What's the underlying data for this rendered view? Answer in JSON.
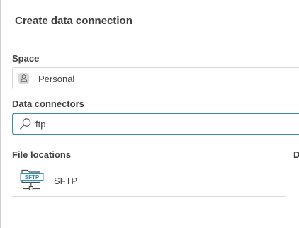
{
  "dialog": {
    "title": "Create data connection"
  },
  "space": {
    "label": "Space",
    "value": "Personal",
    "icon": "person-icon"
  },
  "connectors": {
    "label": "Data connectors",
    "search_value": "ftp",
    "search_icon": "search-icon"
  },
  "results": {
    "section_label": "File locations",
    "right_column_label_clipped": "D",
    "items": [
      {
        "label": "SFTP",
        "icon": "sftp-folder-icon",
        "icon_text": "SFTP"
      }
    ]
  },
  "colors": {
    "focus_border": "#3f8ab3",
    "icon_accent": "#2d8fb5",
    "text": "#404040"
  }
}
